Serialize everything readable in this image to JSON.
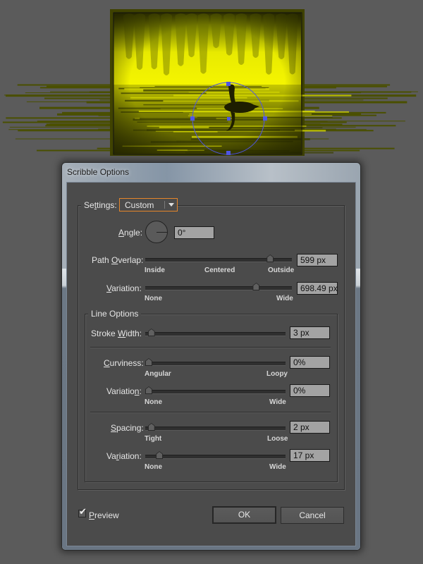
{
  "canvas": {
    "artwork_colors": {
      "yellow": "#f5f500",
      "olive": "#4a4d00",
      "dark": "#1e1e00",
      "selection": "#4f56e6"
    }
  },
  "dialog": {
    "title": "Scribble Options",
    "settings": {
      "label": "Settings:",
      "underline_char": "t",
      "preset_value": "Custom",
      "dropdown_icon": "triangle-down-icon"
    },
    "angle": {
      "label": "Angle:",
      "value": "0°",
      "dial_degrees": 0
    },
    "path_overlap": {
      "label": "Path Overlap:",
      "value": "599 px",
      "slider_fraction": 0.87,
      "ticks": [
        "Inside",
        "Centered",
        "Outside"
      ]
    },
    "overlap_variation": {
      "label": "Variation:",
      "value": "698.49 px",
      "slider_fraction": 0.77,
      "ticks": [
        "None",
        "Wide"
      ]
    },
    "line_options": {
      "legend": "Line Options",
      "stroke_width": {
        "label": "Stroke Width:",
        "value": "3 px",
        "slider_fraction": 0.02
      },
      "curviness": {
        "label": "Curviness:",
        "value": "0%",
        "slider_fraction": 0.0,
        "ticks": [
          "Angular",
          "Loopy"
        ]
      },
      "curviness_variation": {
        "label": "Variation:",
        "value": "0%",
        "slider_fraction": 0.0,
        "ticks": [
          "None",
          "Wide"
        ]
      },
      "spacing": {
        "label": "Spacing:",
        "value": "2 px",
        "slider_fraction": 0.02,
        "ticks": [
          "Tight",
          "Loose"
        ]
      },
      "spacing_variation": {
        "label": "Variation:",
        "value": "17 px",
        "slider_fraction": 0.08,
        "ticks": [
          "None",
          "Wide"
        ]
      }
    },
    "preview": {
      "label": "Preview",
      "checked": true
    },
    "buttons": {
      "ok": "OK",
      "cancel": "Cancel"
    },
    "accent_color": "#e5862a"
  }
}
